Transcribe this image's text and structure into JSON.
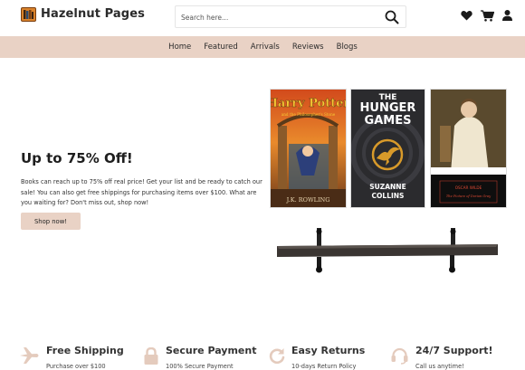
{
  "brand": {
    "name": "Hazelnut Pages",
    "logo_icon": "book-shelf-logo"
  },
  "search": {
    "placeholder": "Search here...",
    "value": ""
  },
  "header_icons": [
    "heart-icon",
    "cart-icon",
    "user-icon"
  ],
  "nav": {
    "items": [
      {
        "label": "Home"
      },
      {
        "label": "Featured"
      },
      {
        "label": "Arrivals"
      },
      {
        "label": "Reviews"
      },
      {
        "label": "Blogs"
      }
    ]
  },
  "hero": {
    "title": "Up to 75% Off!",
    "text": "Books can reach up to 75% off real price! Get your list and be ready to catch our sale! You can also get free shippings for purchasing items over $100. What are you waiting for? Don't miss out, shop now!",
    "button_label": "Shop now!"
  },
  "books": [
    {
      "title": "Harry Potter",
      "subtitle": "and the Philosopher's Stone",
      "author": "J.K. ROWLING"
    },
    {
      "title_line1": "THE",
      "title_line2": "HUNGER",
      "title_line3": "GAMES",
      "author_line1": "SUZANNE",
      "author_line2": "COLLINS"
    },
    {
      "author": "OSCAR WILDE",
      "title": "The Picture of Dorian Gray"
    }
  ],
  "features": [
    {
      "icon": "plane-icon",
      "title": "Free Shipping",
      "subtitle": "Purchase over $100"
    },
    {
      "icon": "lock-icon",
      "title": "Secure Payment",
      "subtitle": "100% Secure Payment"
    },
    {
      "icon": "redo-icon",
      "title": "Easy Returns",
      "subtitle": "10-days Return Policy"
    },
    {
      "icon": "headset-icon",
      "title": "24/7 Support!",
      "subtitle": "Call us anytime!"
    }
  ],
  "colors": {
    "accent": "#e9d2c5",
    "feature_icon": "#e4cbbd",
    "text": "#222222"
  }
}
